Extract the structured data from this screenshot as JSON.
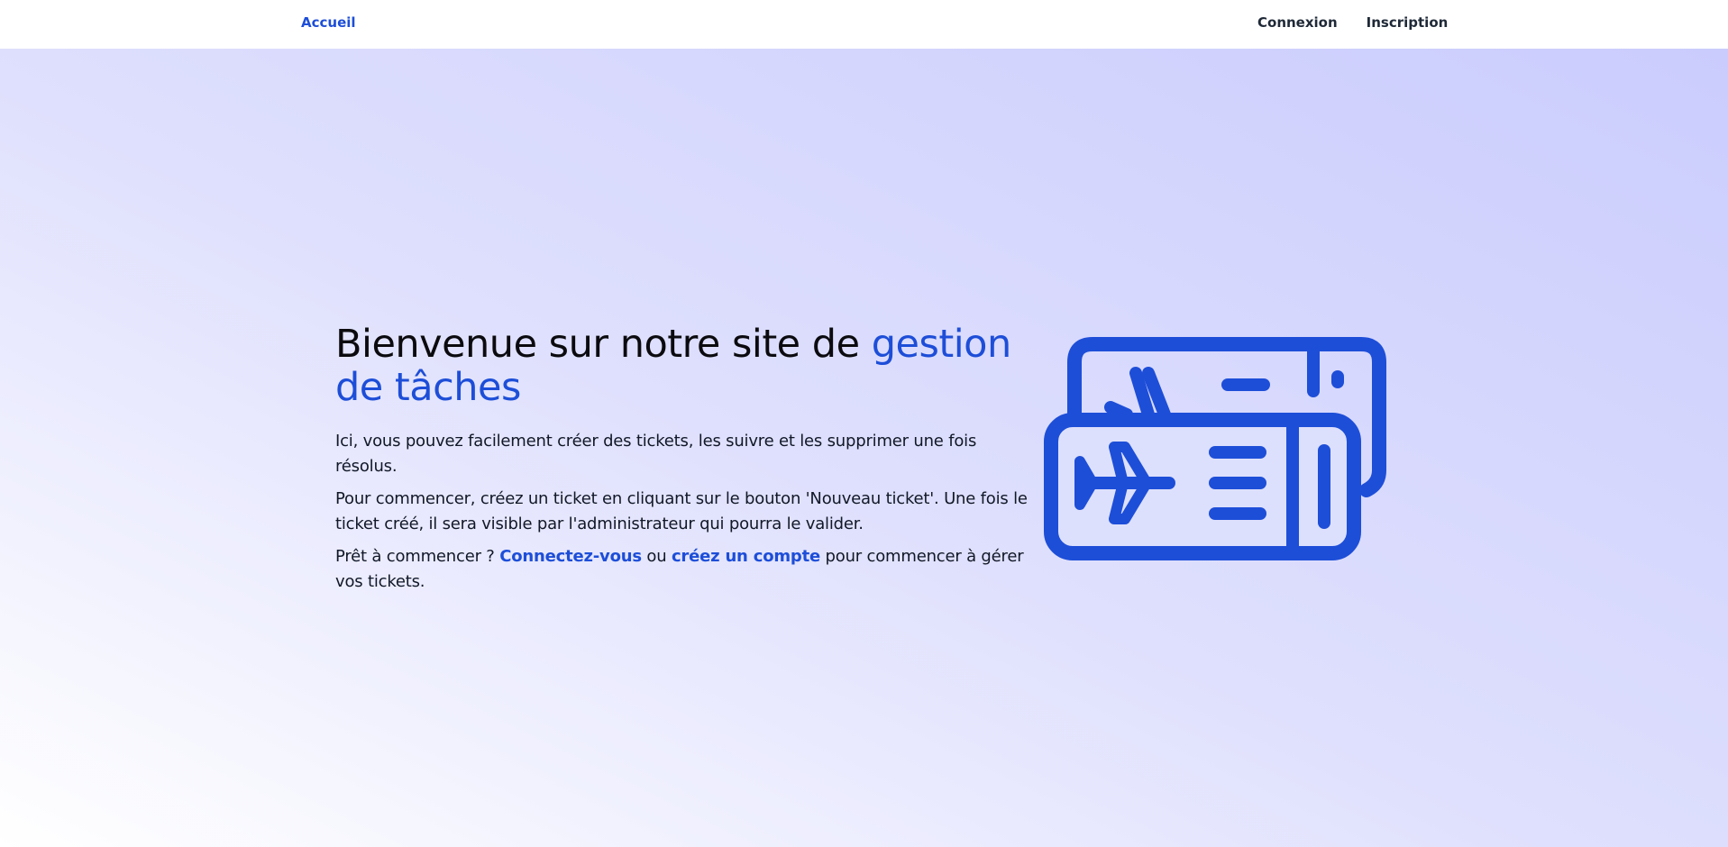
{
  "nav": {
    "home": "Accueil",
    "login": "Connexion",
    "signup": "Inscription"
  },
  "hero": {
    "title_plain": "Bienvenue sur notre site de ",
    "title_accent": "gestion de tâches",
    "p1": "Ici, vous pouvez facilement créer des tickets, les suivre et les supprimer une fois résolus.",
    "p2": "Pour commencer, créez un ticket en cliquant sur le bouton 'Nouveau ticket'. Une fois le ticket créé, il sera visible par l'administrateur qui pourra le valider.",
    "p3_start": "Prêt à commencer ? ",
    "p3_link_login": "Connectez-vous",
    "p3_mid": " ou ",
    "p3_link_signup": "créez un compte",
    "p3_end": " pour commencer à gérer vos tickets."
  },
  "illustration": {
    "icon": "plane-tickets-icon",
    "color": "#1d4ed8"
  },
  "colors": {
    "accent": "#1d4ed8",
    "text": "#111827",
    "nav_bg": "#ffffff"
  }
}
